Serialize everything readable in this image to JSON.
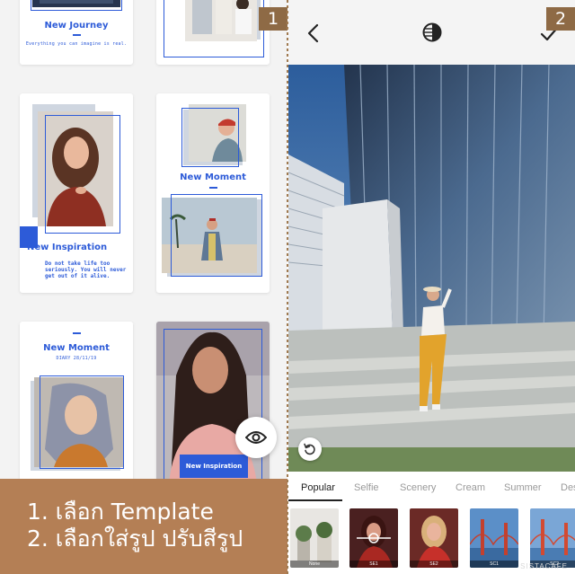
{
  "colors": {
    "accent_blue": "#2d5bd8",
    "caption_brown": "#b47f55",
    "badge_brown": "#8e6a45"
  },
  "step_badges": {
    "one": "1",
    "two": "2"
  },
  "templates": {
    "card1": {
      "title": "New Journey",
      "subtitle": "Everything you can imagine is real."
    },
    "card3": {
      "title": "New Inspiration",
      "body": [
        "Do not take life too",
        "seriously. You will never",
        "get out of it alive."
      ]
    },
    "card4": {
      "title": "New Moment"
    },
    "card5": {
      "title": "New Moment",
      "subtitle": "DIARY 28/11/19"
    },
    "card6": {
      "badge": "New Inspiration"
    }
  },
  "caption": {
    "line1": "1. เลือก Template",
    "line2": "2. เลือกใส่รูป ปรับสีรูป"
  },
  "editor": {
    "icons": {
      "back": "chevron-left-icon",
      "filter": "contrast-icon",
      "confirm": "check-icon",
      "reset": "rotate-ccw-icon",
      "preview": "eye-icon"
    },
    "tabs": [
      "Popular",
      "Selfie",
      "Scenery",
      "Cream",
      "Summer",
      "Des"
    ],
    "active_tab": "Popular",
    "filters": [
      {
        "label": "None"
      },
      {
        "label": "SE1"
      },
      {
        "label": "SE2"
      },
      {
        "label": "SC1"
      },
      {
        "label": "SC2"
      }
    ]
  },
  "watermark": "SISTACAFE"
}
